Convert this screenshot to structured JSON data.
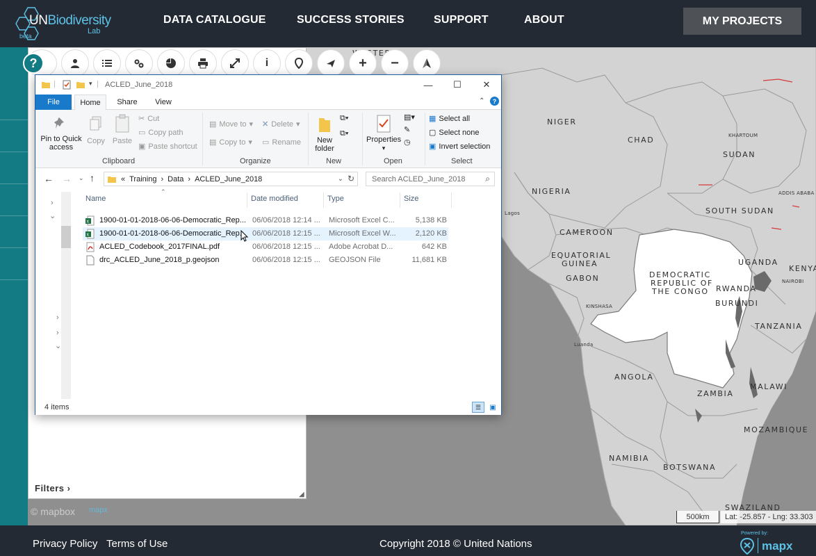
{
  "brand": {
    "name_left": "UN",
    "name_right": "Biodiversity",
    "lab": "Lab",
    "beta": "beta"
  },
  "nav": {
    "items": [
      "DATA CATALOGUE",
      "SUCCESS STORIES",
      "SUPPORT",
      "ABOUT"
    ],
    "my_projects": "MY PROJECTS"
  },
  "map": {
    "help": "?",
    "filters": "Filters ›",
    "labels": {
      "western": "WESTERN",
      "niger": "NIGER",
      "chad": "CHAD",
      "khartoum": "KHARTOUM",
      "sudan": "SUDAN",
      "nigeria": "NIGERIA",
      "south_sudan": "SOUTH SUDAN",
      "addis": "ADDIS ABABA",
      "cameroon": "CAMEROON",
      "equatorial": "EQUATORIAL",
      "guinea": "GUINEA",
      "gabon": "GABON",
      "drc1": "DEMOCRATIC",
      "drc2": "REPUBLIC OF",
      "drc3": "THE CONGO",
      "uganda": "UGANDA",
      "kenya": "KENYA",
      "kinshasa": "KINSHASA",
      "rwanda": "RWANDA",
      "burundi": "BURUNDI",
      "nairobi": "NAIROBI",
      "tanzania": "TANZANIA",
      "angola": "ANGOLA",
      "zambia": "ZAMBIA",
      "malawi": "MALAWI",
      "mozambique": "MOZAMBIQUE",
      "namibia": "NAMIBIA",
      "botswana": "BOTSWANA",
      "swaziland": "SWAZILAND",
      "lagos": "Lagos",
      "luanda": "Luanda"
    },
    "mapbox": "© mapbox",
    "mapx": "mapx",
    "scale": "500km",
    "coords": "Lat: -25.857 - Lng: 33.303"
  },
  "toolbar": {
    "icons": [
      "user-icon",
      "list-icon",
      "settings-icon",
      "pie-chart-icon",
      "print-icon",
      "fullscreen-icon",
      "info-icon",
      "location-pin-icon",
      "airplane-icon",
      "zoom-in-icon",
      "zoom-out-icon",
      "north-arrow-icon"
    ],
    "glyphs": [
      "",
      "",
      "",
      "",
      "",
      "",
      "i",
      "",
      "",
      "+",
      "−",
      ""
    ]
  },
  "explorer": {
    "title": "ACLED_June_2018",
    "tabs": [
      "File",
      "Home",
      "Share",
      "View"
    ],
    "clipboard": {
      "pin": "Pin to Quick access",
      "copy": "Copy",
      "paste": "Paste",
      "cut": "Cut",
      "copy_path": "Copy path",
      "paste_shortcut": "Paste shortcut",
      "label": "Clipboard"
    },
    "organize": {
      "move_to": "Move to",
      "copy_to": "Copy to",
      "delete": "Delete",
      "rename": "Rename",
      "label": "Organize"
    },
    "new": {
      "new_folder": "New folder",
      "label": "New"
    },
    "open": {
      "properties": "Properties",
      "label": "Open"
    },
    "select": {
      "select_all": "Select all",
      "select_none": "Select none",
      "invert": "Invert selection",
      "label": "Select"
    },
    "breadcrumb": [
      "«",
      "Training",
      "›",
      "Data",
      "›",
      "ACLED_June_2018"
    ],
    "search_placeholder": "Search ACLED_June_2018",
    "columns": [
      "Name",
      "Date modified",
      "Type",
      "Size"
    ],
    "files": [
      {
        "name": "1900-01-01-2018-06-06-Democratic_Rep...",
        "date": "06/06/2018 12:14 ...",
        "type": "Microsoft Excel C...",
        "size": "5,138 KB",
        "icon": "excel-icon"
      },
      {
        "name": "1900-01-01-2018-06-06-Democratic_Rep...",
        "date": "06/06/2018 12:15 ...",
        "type": "Microsoft Excel W...",
        "size": "2,120 KB",
        "icon": "excel-icon"
      },
      {
        "name": "ACLED_Codebook_2017FINAL.pdf",
        "date": "06/06/2018 12:15 ...",
        "type": "Adobe Acrobat D...",
        "size": "642 KB",
        "icon": "pdf-icon"
      },
      {
        "name": "drc_ACLED_June_2018_p.geojson",
        "date": "06/06/2018 12:15 ...",
        "type": "GEOJSON File",
        "size": "11,681 KB",
        "icon": "file-icon"
      }
    ],
    "status": "4 items"
  },
  "footer": {
    "privacy": "Privacy Policy",
    "terms": "Terms of Use",
    "copyright": "Copyright 2018 © United Nations",
    "powered": "Powered by:",
    "mapx": "mapx"
  }
}
